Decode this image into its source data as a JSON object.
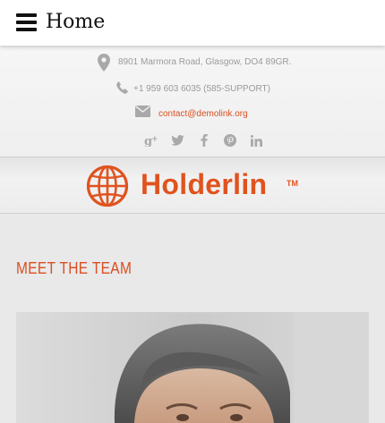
{
  "header": {
    "title": "Home",
    "menu_icon": "hamburger-menu-icon"
  },
  "contact": {
    "address": "8901 Marmora Road, Glasgow, DO4 89GR.",
    "phone": "+1 959 603 6035 (585-SUPPORT)",
    "email": "contact@demolink.org",
    "icons": {
      "address": "map-pin-icon",
      "phone": "phone-icon",
      "email": "envelope-icon"
    }
  },
  "social": [
    "google-plus-icon",
    "twitter-icon",
    "facebook-icon",
    "pinterest-icon",
    "linkedin-icon"
  ],
  "brand": {
    "name": "Holderlin",
    "tm": "TM"
  },
  "team": {
    "heading": "MEET THE TEAM"
  },
  "colors": {
    "accent": "#e0531f",
    "muted_text": "#9a9a9a",
    "band": "#e9e9e9"
  }
}
